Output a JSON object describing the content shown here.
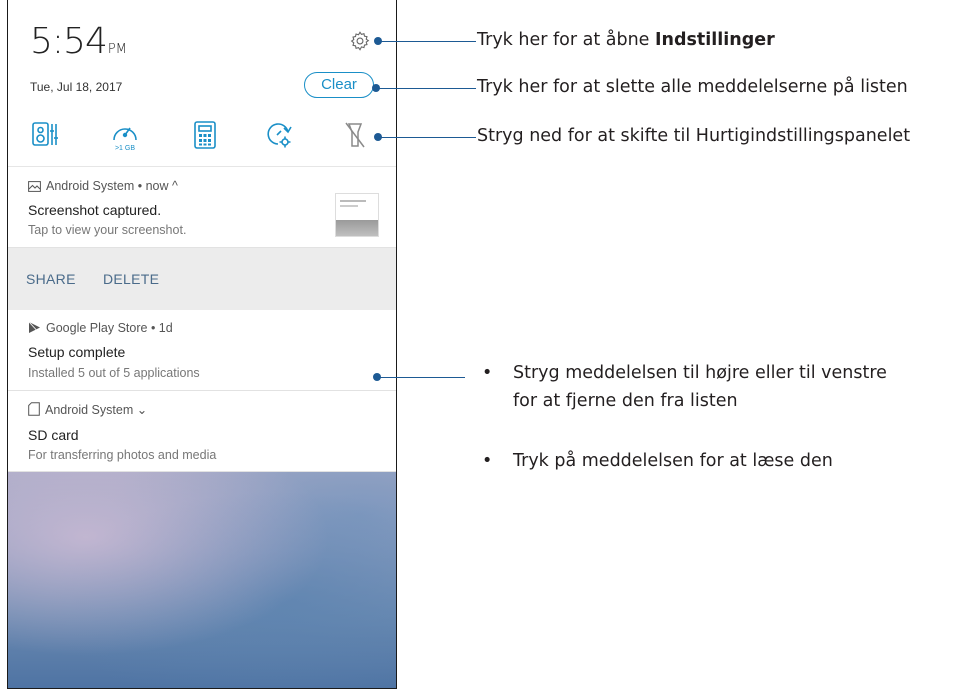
{
  "status": {
    "time_digits": "5:54",
    "time_suffix": "PM",
    "date": "Tue, Jul 18, 2017"
  },
  "header": {
    "clear_label": "Clear"
  },
  "quick_settings": [
    {
      "icon": "audio-wizard-icon",
      "label": ""
    },
    {
      "icon": "boost-icon",
      "label": ">1 GB"
    },
    {
      "icon": "calculator-icon",
      "label": ""
    },
    {
      "icon": "sync-settings-icon",
      "label": ""
    },
    {
      "icon": "flashlight-off-icon",
      "label": ""
    }
  ],
  "notifications": [
    {
      "app": "Android System",
      "meta": "• now ^",
      "title": "Screenshot captured.",
      "body": "Tap to view your screenshot.",
      "actions": [
        "SHARE",
        "DELETE"
      ]
    },
    {
      "app": "Google Play Store",
      "meta": "• 1d",
      "title": "Setup complete",
      "body": "Installed 5 out of 5 applications"
    },
    {
      "app": "Android System",
      "meta": "⌄",
      "title": "SD card",
      "body": "For transferring photos and media"
    }
  ],
  "callouts": {
    "settings_prefix": "Tryk her for at åbne ",
    "settings_bold": "Indstillinger",
    "clear": "Tryk her for at slette alle meddelelserne på listen",
    "quick": "Stryg ned for at skifte til Hurtigindstillingspanelet",
    "swipe_line1": "Stryg meddelelsen til højre eller til venstre",
    "swipe_line2": "for at fjerne den fra listen",
    "tap": "Tryk på meddelelsen for at læse den",
    "bullet": "•"
  },
  "colors": {
    "accent": "#1a8fc7",
    "callout_line": "#1d5a94",
    "action_text": "#4a6b8a"
  }
}
